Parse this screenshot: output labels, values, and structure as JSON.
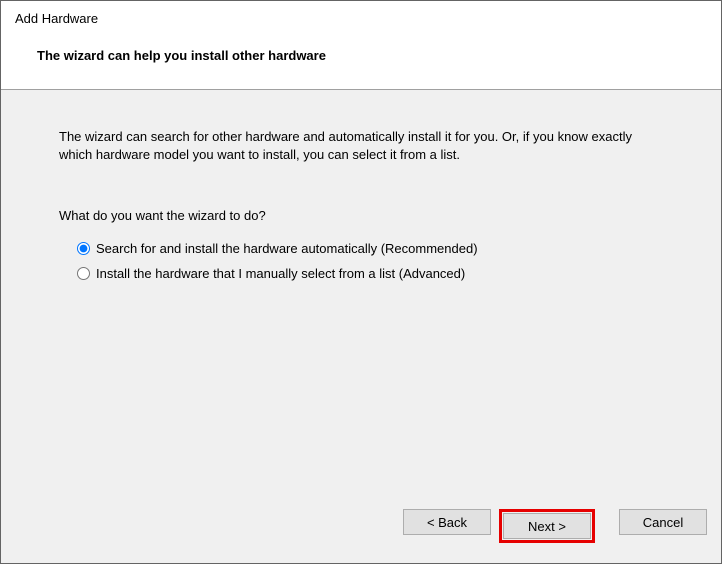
{
  "dialog": {
    "title": "Add Hardware",
    "subtitle": "The wizard can help you install other hardware"
  },
  "content": {
    "description": "The wizard can search for other hardware and automatically install it for you. Or, if you know exactly which hardware model you want to install, you can select it from a list.",
    "question": "What do you want the wizard to do?",
    "options": {
      "auto": "Search for and install the hardware automatically (Recommended)",
      "manual": "Install the hardware that I manually select from a list (Advanced)"
    }
  },
  "buttons": {
    "back": "< Back",
    "next": "Next >",
    "cancel": "Cancel"
  }
}
